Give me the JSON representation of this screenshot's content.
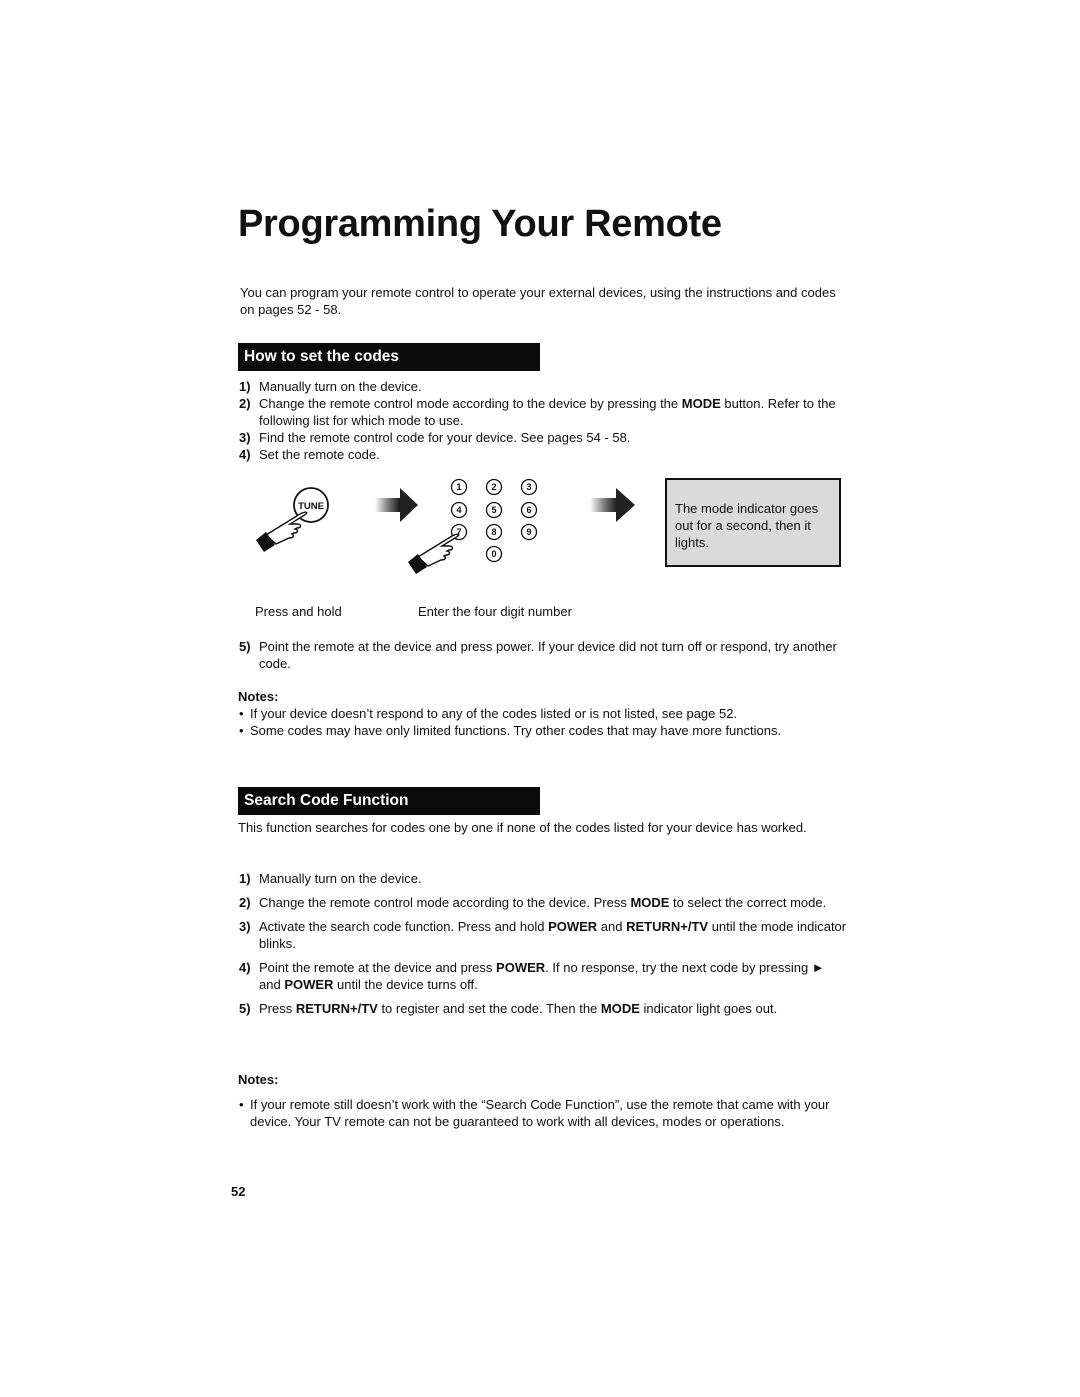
{
  "page": {
    "title": "Programming Your Remote",
    "intro": "You can program your remote control to operate your external devices, using the instructions and codes on pages 52 - 58.",
    "page_number": "52"
  },
  "how_to_set": {
    "heading": "How to set the codes",
    "steps": [
      {
        "num": "1)",
        "text": "Manually turn on the device."
      },
      {
        "num": "2)",
        "pre": "Change the remote control mode according to the device by pressing the ",
        "bold": "MODE",
        "post": " button. Refer to the following list for which mode to use."
      },
      {
        "num": "3)",
        "text": "Find the remote control code for your device.  See pages 54 - 58."
      },
      {
        "num": "4)",
        "text": "Set the remote code."
      }
    ],
    "illustration": {
      "tune_label": "TUNE",
      "keypad_digits": [
        "1",
        "2",
        "3",
        "4",
        "5",
        "6",
        "7",
        "8",
        "9",
        "0"
      ],
      "mode_box_text": "The mode indicator goes out for a second, then it lights.",
      "caption_press": "Press and hold",
      "caption_enter": "Enter the four digit number"
    },
    "step5": {
      "num": "5)",
      "text": "Point the remote at the device and press power.  If your device did not turn off or respond, try another code."
    },
    "notes_heading": "Notes:",
    "notes": [
      "If your device doesn’t respond to any of the codes listed or is not listed, see page 52.",
      "Some codes may have only limited functions.  Try other codes that may have more functions."
    ]
  },
  "search_code": {
    "heading": "Search Code Function",
    "intro": "This function searches for codes one by one if none of the codes listed for your device has worked.",
    "steps": [
      {
        "num": "1)",
        "p1": "Manually turn on the device."
      },
      {
        "num": "2)",
        "p1": "Change the remote control mode according to the device.  Press ",
        "b1": "MODE",
        "p2": " to select the correct mode."
      },
      {
        "num": "3)",
        "p1": "Activate the search code function.  Press and hold ",
        "b1": "POWER",
        "p2": " and ",
        "b2": "RETURN+/TV",
        "p3": " until the mode indicator blinks."
      },
      {
        "num": "4)",
        "p1": "Point the remote at the device and press ",
        "b1": "POWER",
        "p2": ".  If no response, try the next code by pressing ► and ",
        "b2": "POWER",
        "p3": " until the device turns off."
      },
      {
        "num": "5)",
        "p1": "Press ",
        "b1": "RETURN+/TV",
        "p2": " to register and set the code.  Then the ",
        "b2": "MODE",
        "p3": " indicator light goes out."
      }
    ],
    "notes_heading": "Notes:",
    "notes": [
      "If your remote still doesn’t work with the “Search Code Function”, use the remote that came with your device.  Your TV remote can not be guaranteed to work with all devices, modes or operations."
    ]
  }
}
